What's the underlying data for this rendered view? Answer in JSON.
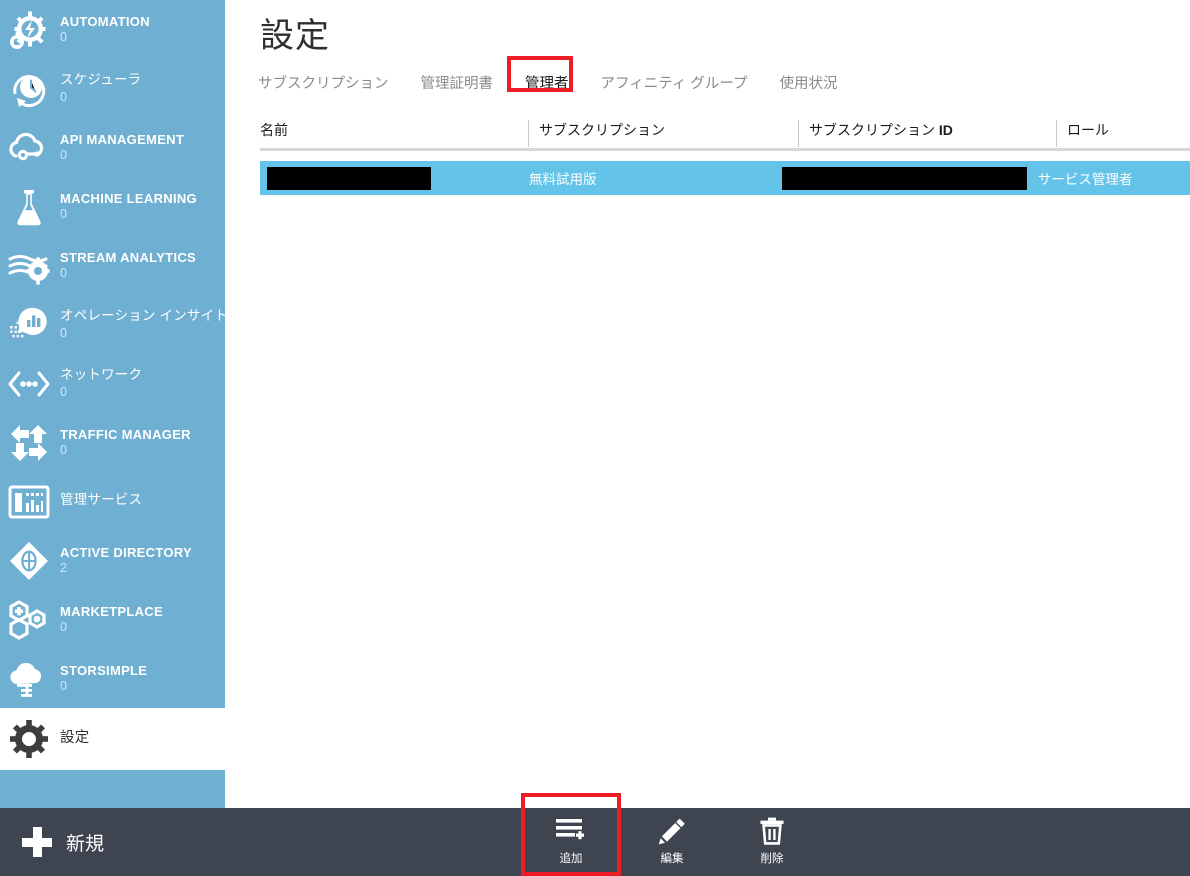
{
  "sidebar": {
    "items": [
      {
        "label": "AUTOMATION",
        "count": "0",
        "icon": "gears-lightning-icon",
        "upper": true
      },
      {
        "label": "スケジューラ",
        "count": "0",
        "icon": "clock-refresh-icon",
        "upper": false
      },
      {
        "label": "API MANAGEMENT",
        "count": "0",
        "icon": "cloud-api-icon",
        "upper": true
      },
      {
        "label": "MACHINE LEARNING",
        "count": "0",
        "icon": "flask-icon",
        "upper": true
      },
      {
        "label": "STREAM ANALYTICS",
        "count": "0",
        "icon": "stream-gear-icon",
        "upper": true
      },
      {
        "label": "オペレーション インサイト",
        "count": "0",
        "icon": "insight-bubble-chart-icon",
        "upper": false
      },
      {
        "label": "ネットワーク",
        "count": "0",
        "icon": "network-dots-icon",
        "upper": false
      },
      {
        "label": "TRAFFIC MANAGER",
        "count": "0",
        "icon": "traffic-arrows-icon",
        "upper": true
      },
      {
        "label": "管理サービス",
        "count": "",
        "icon": "management-services-icon",
        "upper": false
      },
      {
        "label": "ACTIVE DIRECTORY",
        "count": "2",
        "icon": "active-directory-diamond-icon",
        "upper": true
      },
      {
        "label": "MARKETPLACE",
        "count": "0",
        "icon": "marketplace-hex-icon",
        "upper": true
      },
      {
        "label": "STORSIMPLE",
        "count": "0",
        "icon": "storsimple-cloud-icon",
        "upper": true
      }
    ],
    "settings": {
      "label": "設定",
      "icon": "gear-icon"
    }
  },
  "main": {
    "title": "設定",
    "tabs": [
      {
        "label": "サブスクリプション",
        "active": false
      },
      {
        "label": "管理証明書",
        "active": false
      },
      {
        "label": "管理者",
        "active": true
      },
      {
        "label": "アフィニティ グループ",
        "active": false
      },
      {
        "label": "使用状況",
        "active": false
      }
    ],
    "table": {
      "headers": [
        "名前",
        "サブスクリプション",
        "サブスクリプション ID",
        "ロール"
      ],
      "subscription_id_suffix": "ID",
      "rows": [
        {
          "name": "",
          "name_redacted": true,
          "subscription": "無料試用版",
          "subscription_id": "",
          "subscription_id_redacted": true,
          "role": "サービス管理者",
          "selected": true
        }
      ]
    }
  },
  "bottombar": {
    "new_label": "新規",
    "new_icon": "plus-icon",
    "actions": [
      {
        "label": "追加",
        "icon": "add-lines-icon",
        "annotated": true
      },
      {
        "label": "編集",
        "icon": "pencil-icon",
        "annotated": false
      },
      {
        "label": "削除",
        "icon": "trash-icon",
        "annotated": false
      }
    ]
  },
  "colors": {
    "sidebar_blue": "#6FAFD2",
    "row_highlight": "#63C3E9",
    "toolbar_dark": "#3E4551",
    "annotation_red": "#EE1C25",
    "title_text": "#2F2F2F",
    "tab_inactive": "#8A8A8A"
  }
}
